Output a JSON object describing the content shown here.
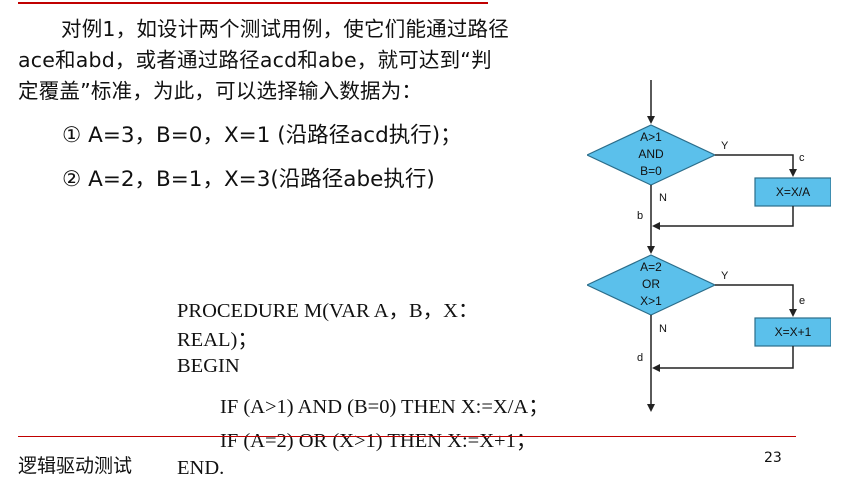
{
  "paragraph": {
    "line1": "对例1，如设计两个测试用例，使它们能通过路径",
    "line2": "ace和abd，或者通过路径acd和abe，就可达到“判",
    "line3": "定覆盖”标准，为此，可以选择输入数据为："
  },
  "cases": [
    "① A=3，B=0，X=1 (沿路径acd执行)；",
    "② A=2，B=1，X=3(沿路径abe执行)"
  ],
  "code": {
    "line1": "PROCEDURE  M(VAR A，B，X：",
    "line2": "REAL)；",
    "line3": "BEGIN",
    "line4": "IF (A>1) AND (B=0)  THEN X:=X/A；",
    "line5": "IF (A=2) OR (X>1)   THEN X:=X+1；",
    "line6": "END."
  },
  "flowchart": {
    "decision1": [
      "A>1",
      "AND",
      "B=0"
    ],
    "decision2": [
      "A=2",
      "OR",
      "X>1"
    ],
    "process1": "X=X/A",
    "process2": "X=X+1",
    "yes1": "Y",
    "no1": "N",
    "yes2": "Y",
    "no2": "N",
    "path_c": "c",
    "path_b": "b",
    "path_e": "e",
    "path_d": "d",
    "colors": {
      "fill": "#5bc0eb",
      "stroke": "#2b6d8a",
      "line": "#222222"
    }
  },
  "footer": {
    "title": "逻辑驱动测试",
    "page": "23"
  },
  "colors": {
    "accent_rule": "#c00000"
  }
}
